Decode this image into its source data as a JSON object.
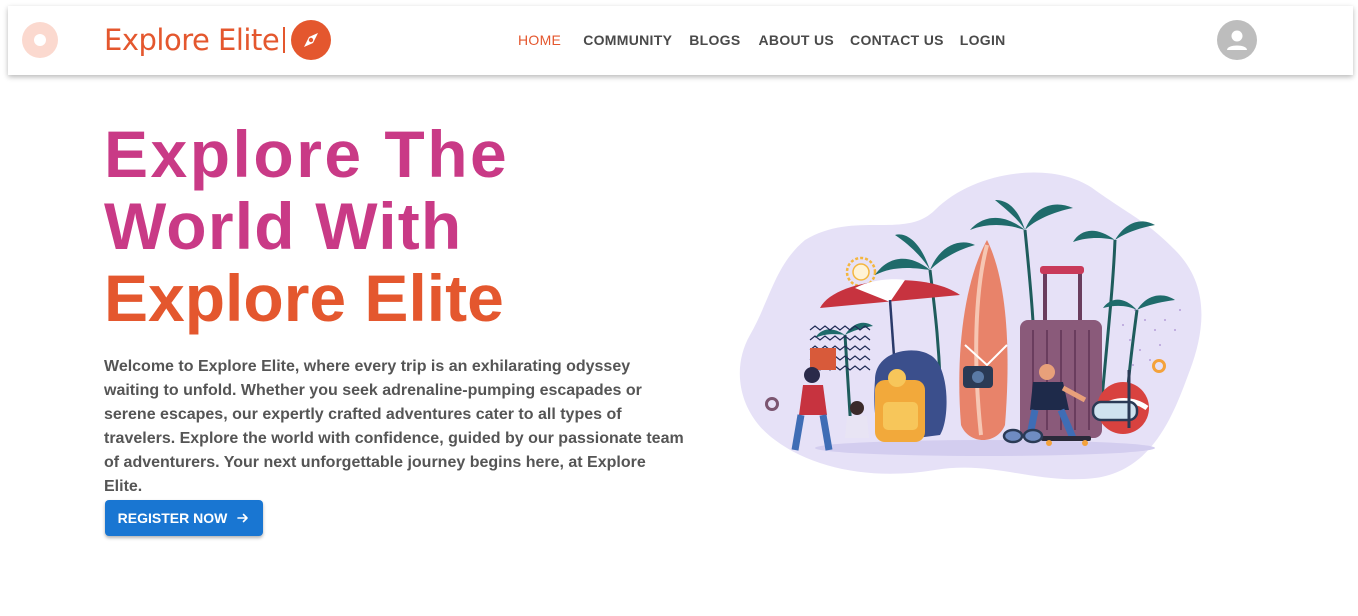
{
  "navbar": {
    "logo_text": "Explore Elite",
    "links": [
      {
        "label": "HOME",
        "active": true
      },
      {
        "label": "COMMUNITY"
      },
      {
        "label": "BLOGS"
      },
      {
        "label": "ABOUT US"
      },
      {
        "label": "CONTACT US"
      },
      {
        "label": "LOGIN"
      }
    ],
    "avatar_icon": "account-circle-icon"
  },
  "hero": {
    "title_line1": "Explore The",
    "title_line2": "World With",
    "title_line3": "Explore Elite",
    "description": "Welcome to Explore Elite, where every trip is an exhilarating odyssey waiting to unfold. Whether you seek adrenaline-pumping escapades or serene escapes, our expertly crafted adventures cater to all types of travelers. Explore the world with confidence, guided by our passionate team of adventurers. Your next unforgettable journey begins here, at Explore Elite.",
    "register_label": "REGISTER NOW",
    "register_icon": "arrow-right-icon"
  },
  "colors": {
    "brand_orange": "#e4572e",
    "title_pink": "#c93a86",
    "button_blue": "#1976d2"
  }
}
